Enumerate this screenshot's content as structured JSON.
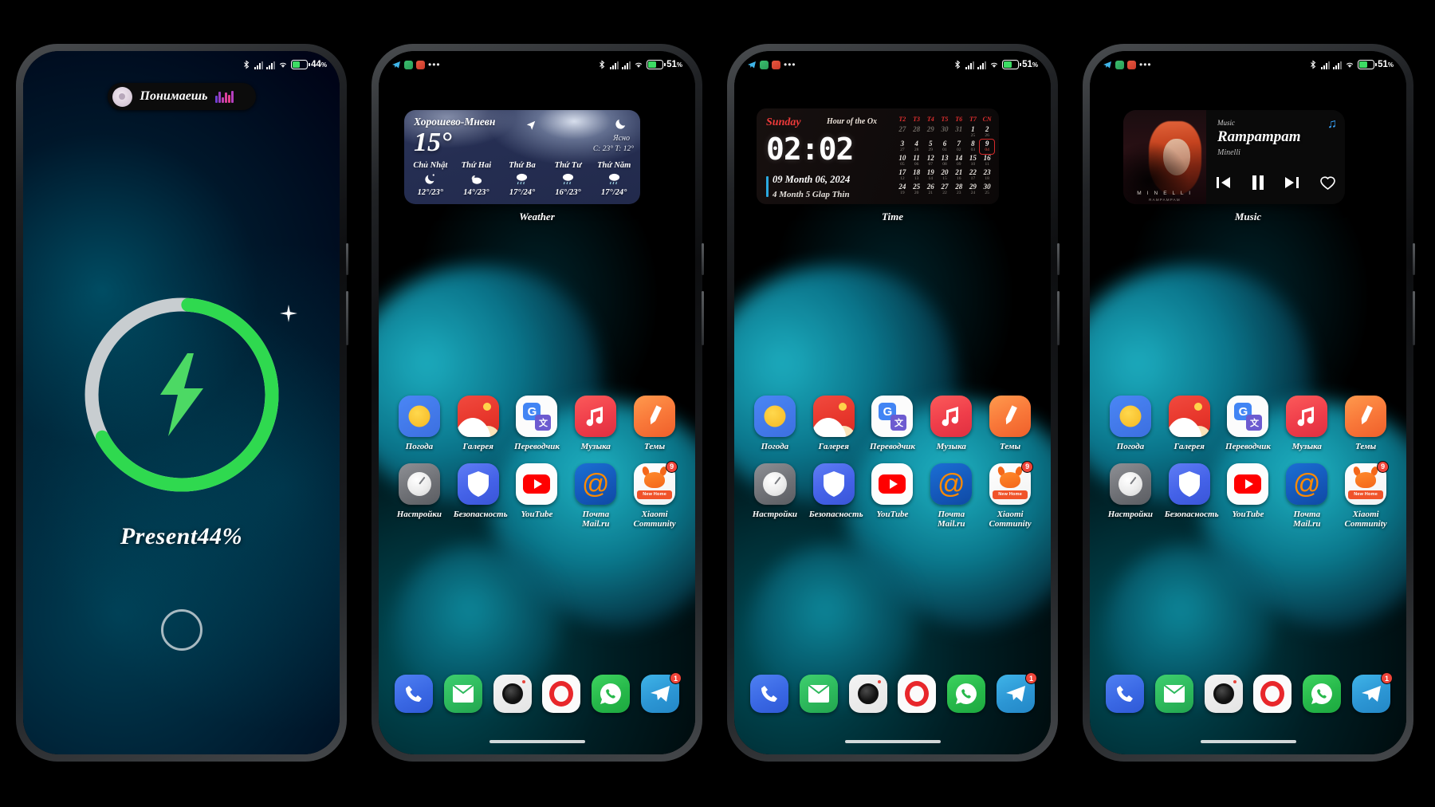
{
  "phones": [
    {
      "id": "charging",
      "statusbar": {
        "left_icons": [],
        "bluetooth": "bluetooth-icon",
        "signal1": "signal-bars-icon",
        "signal2": "signal-bars-icon",
        "wifi": "wifi-icon",
        "battery_percent": "44",
        "percent_sign": "%"
      },
      "music_pill": {
        "title": "Понимаешь",
        "art": "album-art-icon",
        "equalizer": "equalizer-icon"
      },
      "charging": {
        "percent_label": "Present44%",
        "ring_percent": 66,
        "ring_fill_color": "#2fd94f",
        "ring_track_color": "#c8cdd0",
        "bolt_color": "#4cd964",
        "sparkle": "sparkle-icon",
        "home_indicator": "home-circle-icon"
      }
    },
    {
      "id": "weather",
      "statusbar": {
        "battery_percent": "51",
        "percent_sign": "%"
      },
      "widget": {
        "label": "Weather",
        "city": "Хорошево-Мневн",
        "temp": "15°",
        "condition": "Ясно",
        "hilo": "C: 23°  T: 12°",
        "nav_icon": "navigation-arrow-icon",
        "moon_icon": "moon-icon",
        "days": [
          {
            "name": "Chủ Nhật",
            "icon": "moon-crescent-icon",
            "temp": "12°/23°"
          },
          {
            "name": "Thứ Hai",
            "icon": "partly-cloudy-night-icon",
            "temp": "14°/23°"
          },
          {
            "name": "Thứ Ba",
            "icon": "rain-icon",
            "temp": "17°/24°"
          },
          {
            "name": "Thứ Tư",
            "icon": "rain-icon",
            "temp": "16°/23°"
          },
          {
            "name": "Thứ Năm",
            "icon": "rain-icon",
            "temp": "17°/24°"
          }
        ]
      }
    },
    {
      "id": "time",
      "statusbar": {
        "battery_percent": "51",
        "percent_sign": "%"
      },
      "widget": {
        "label": "Time",
        "weekday": "Sunday",
        "hour_branch": "Hour of the Ox",
        "clock": "02:02",
        "date_line1": "09 Month 06, 2024",
        "date_line2": "4 Month 5 Glap Thin",
        "calendar": {
          "headers": [
            "T2",
            "T3",
            "T4",
            "T5",
            "T6",
            "T7",
            "CN"
          ],
          "weeks": [
            [
              {
                "n": "27",
                "s": "",
                "dim": true
              },
              {
                "n": "28",
                "s": "",
                "dim": true
              },
              {
                "n": "29",
                "s": "",
                "dim": true
              },
              {
                "n": "30",
                "s": "",
                "dim": true
              },
              {
                "n": "31",
                "s": "",
                "dim": true
              },
              {
                "n": "1",
                "s": "25",
                "dim": false
              },
              {
                "n": "2",
                "s": "26",
                "dim": false
              }
            ],
            [
              {
                "n": "3",
                "s": "27"
              },
              {
                "n": "4",
                "s": "28"
              },
              {
                "n": "5",
                "s": "29"
              },
              {
                "n": "6",
                "s": "01"
              },
              {
                "n": "7",
                "s": "02"
              },
              {
                "n": "8",
                "s": "03"
              },
              {
                "n": "9",
                "s": "04",
                "today": true
              }
            ],
            [
              {
                "n": "10",
                "s": "05"
              },
              {
                "n": "11",
                "s": "06"
              },
              {
                "n": "12",
                "s": "07"
              },
              {
                "n": "13",
                "s": "08"
              },
              {
                "n": "14",
                "s": "09"
              },
              {
                "n": "15",
                "s": "10"
              },
              {
                "n": "16",
                "s": "11"
              }
            ],
            [
              {
                "n": "17",
                "s": "12"
              },
              {
                "n": "18",
                "s": "13"
              },
              {
                "n": "19",
                "s": "14"
              },
              {
                "n": "20",
                "s": "15"
              },
              {
                "n": "21",
                "s": "16"
              },
              {
                "n": "22",
                "s": "17"
              },
              {
                "n": "23",
                "s": "18"
              }
            ],
            [
              {
                "n": "24",
                "s": "19"
              },
              {
                "n": "25",
                "s": "20"
              },
              {
                "n": "26",
                "s": "21"
              },
              {
                "n": "27",
                "s": "22"
              },
              {
                "n": "28",
                "s": "23"
              },
              {
                "n": "29",
                "s": "24"
              },
              {
                "n": "30",
                "s": "25"
              }
            ]
          ]
        }
      }
    },
    {
      "id": "music",
      "statusbar": {
        "battery_percent": "51",
        "percent_sign": "%"
      },
      "widget": {
        "label": "Music",
        "kicker": "Music",
        "track": "Rampampam",
        "artist": "Minelli",
        "album_caption": "M I N E L L I",
        "album_caption2": "RAMPAMPAM",
        "note_icon": "music-note-icon",
        "controls": [
          {
            "name": "previous-track-button",
            "icon": "skip-back-icon"
          },
          {
            "name": "pause-button",
            "icon": "pause-icon"
          },
          {
            "name": "next-track-button",
            "icon": "skip-forward-icon"
          },
          {
            "name": "favorite-button",
            "icon": "heart-icon"
          }
        ]
      }
    }
  ],
  "home": {
    "row1": [
      {
        "label": "Погода",
        "icon": "weather-app-icon"
      },
      {
        "label": "Галерея",
        "icon": "gallery-app-icon"
      },
      {
        "label": "Переводчик",
        "icon": "translate-app-icon"
      },
      {
        "label": "Музыка",
        "icon": "music-app-icon"
      },
      {
        "label": "Темы",
        "icon": "themes-app-icon"
      }
    ],
    "row2": [
      {
        "label": "Настройки",
        "icon": "settings-app-icon"
      },
      {
        "label": "Безопасность",
        "icon": "security-app-icon"
      },
      {
        "label": "YouTube",
        "icon": "youtube-app-icon"
      },
      {
        "label": "Почта Mail.ru",
        "icon": "mailru-app-icon"
      },
      {
        "label": "Xiaomi Community",
        "icon": "xiaomi-community-app-icon",
        "badge": "9",
        "strip": "New Home"
      }
    ],
    "dock": [
      {
        "name": "phone-app-icon",
        "badge": ""
      },
      {
        "name": "messages-app-icon",
        "badge": ""
      },
      {
        "name": "camera-app-icon",
        "badge": ""
      },
      {
        "name": "opera-app-icon",
        "badge": ""
      },
      {
        "name": "whatsapp-app-icon",
        "badge": ""
      },
      {
        "name": "telegram-app-icon",
        "badge": "1"
      }
    ]
  },
  "colors": {
    "accent_teal": "#1fb6c9",
    "charge_green": "#2fd94f",
    "badge_red": "#f0453a",
    "calendar_red": "#e02f2f"
  }
}
